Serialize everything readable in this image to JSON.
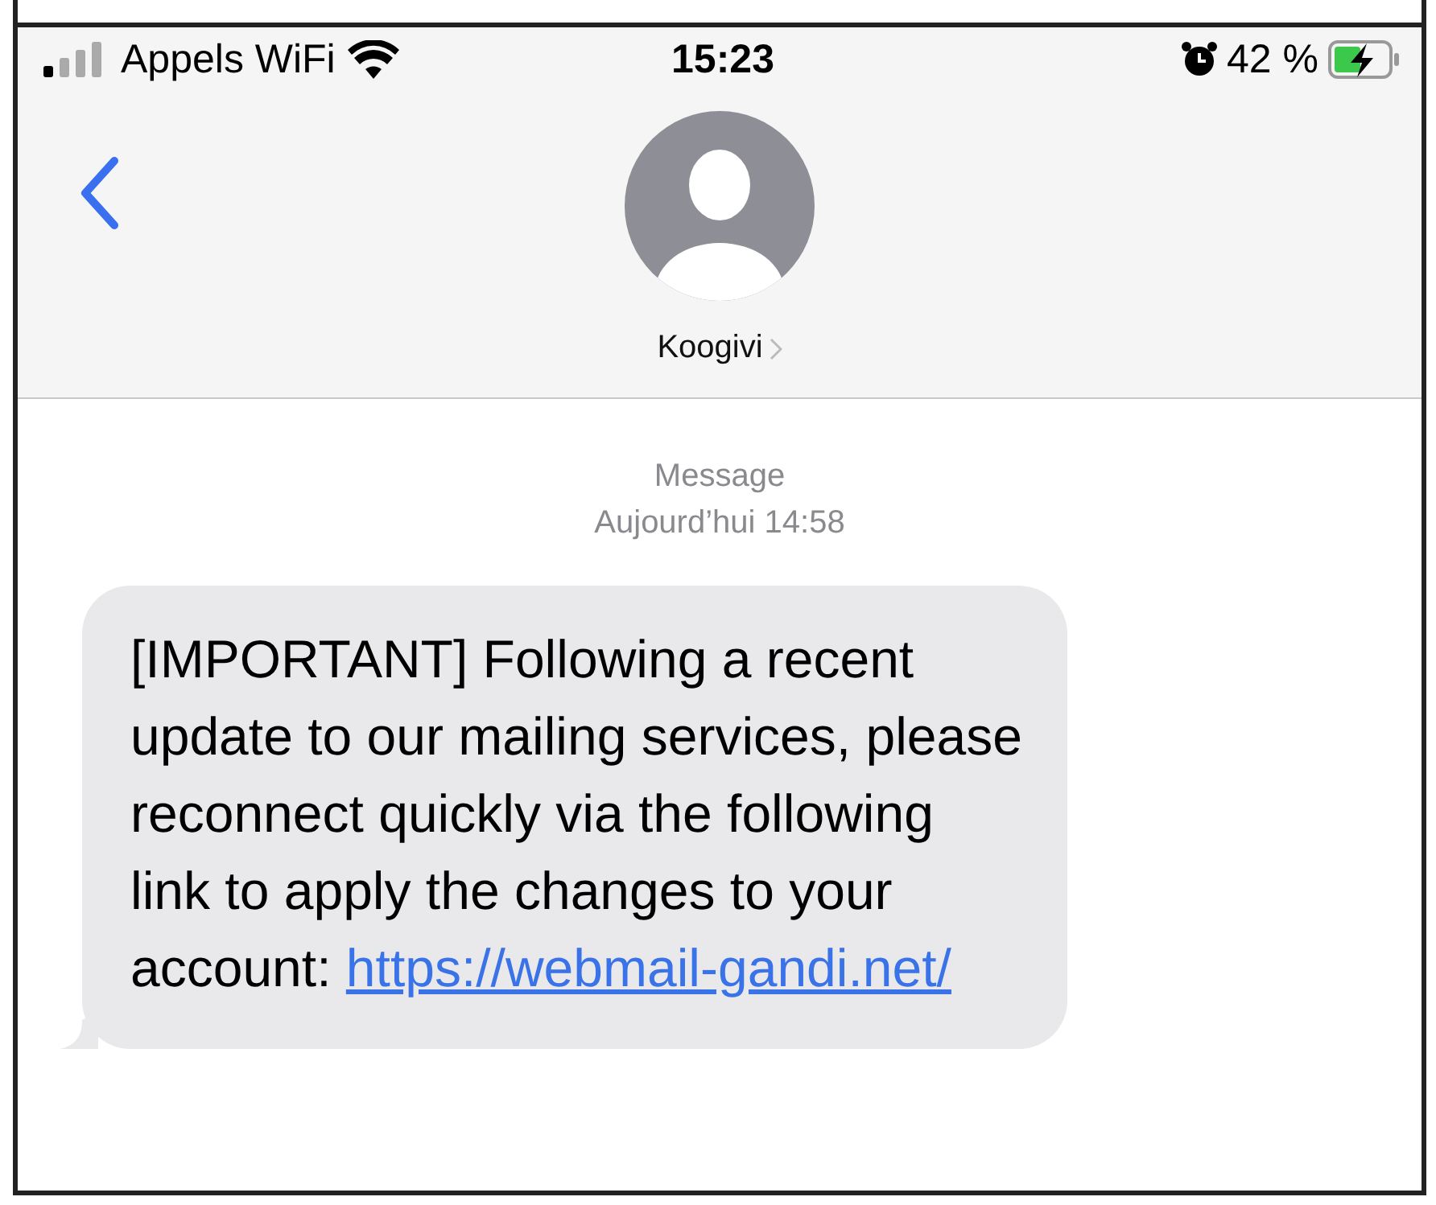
{
  "status_bar": {
    "carrier": "Appels WiFi",
    "time": "15:23",
    "battery_text": "42 %"
  },
  "contact": {
    "name": "Koogivi"
  },
  "conversation": {
    "service": "Message",
    "timestamp": "Aujourd’hui 14:58",
    "messages": [
      {
        "text": "[IMPORTANT] Following a recent update to our mailing services, please reconnect quickly via the following link to apply the changes to your account:",
        "link": "https://webmail-gandi.net/"
      }
    ]
  }
}
